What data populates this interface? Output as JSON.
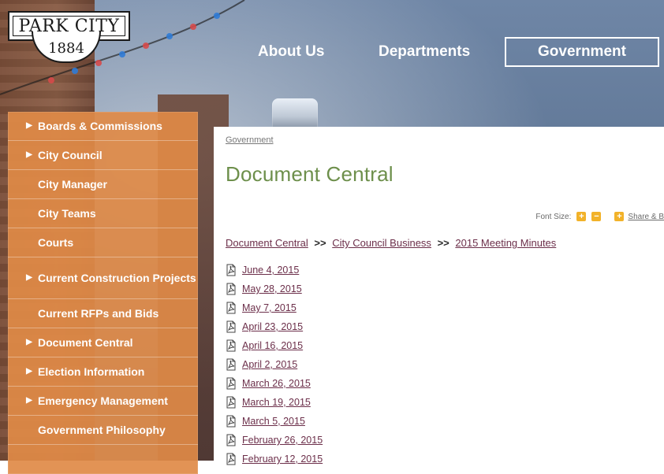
{
  "brand": {
    "name": "PARK CITY",
    "year": "1884"
  },
  "nav": {
    "items": [
      {
        "label": "About Us"
      },
      {
        "label": "Departments"
      },
      {
        "label": "Government"
      }
    ]
  },
  "sidebar": {
    "items": [
      {
        "label": "Boards & Commissions",
        "has_children": true
      },
      {
        "label": "City Council",
        "has_children": true
      },
      {
        "label": "City Manager",
        "has_children": false
      },
      {
        "label": "City Teams",
        "has_children": false
      },
      {
        "label": "Courts",
        "has_children": false
      },
      {
        "label": "Current Construction Projects",
        "has_children": true
      },
      {
        "label": "Current RFPs and Bids",
        "has_children": false
      },
      {
        "label": "Document Central",
        "has_children": true
      },
      {
        "label": "Election Information",
        "has_children": true
      },
      {
        "label": "Emergency Management",
        "has_children": true
      },
      {
        "label": "Government Philosophy",
        "has_children": false
      }
    ]
  },
  "content": {
    "breadcrumb_top": "Government",
    "title": "Document Central",
    "tools": {
      "font_size_label": "Font Size:",
      "increase_label": "+",
      "decrease_label": "−",
      "share_label": "Share & B"
    },
    "path": {
      "a": "Document Central",
      "b": "City Council Business",
      "c": "2015 Meeting Minutes",
      "separator": ">>"
    },
    "documents": [
      "June 4, 2015",
      "May 28, 2015",
      "May 7, 2015",
      "April 23, 2015",
      "April 16, 2015",
      "April 2, 2015",
      "March 26, 2015",
      "March 19, 2015",
      "March 5, 2015",
      "February 26, 2015",
      "February 12, 2015"
    ]
  },
  "colors": {
    "accent_title": "#6d8f4b",
    "link": "#6c2f4a",
    "sidebar_bg": "#e08a46",
    "tool_button": "#f2b229"
  }
}
